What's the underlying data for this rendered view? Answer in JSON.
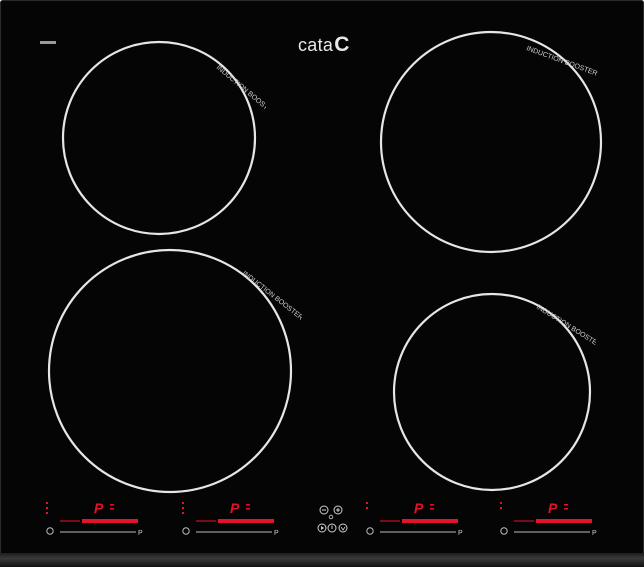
{
  "brand": {
    "name": "cata",
    "logo_mark": "C"
  },
  "zones": [
    {
      "id": "top-left",
      "label": "INDUCTION BOOSTER"
    },
    {
      "id": "bottom-left",
      "label": "INDUCTION BOOSTER"
    },
    {
      "id": "top-right",
      "label": "INDUCTION BOOSTER"
    },
    {
      "id": "bottom-right",
      "label": "INDUCTION BOOSTER"
    }
  ],
  "controls": {
    "zone_panels": [
      {
        "display": "P",
        "power_level_max": "P"
      },
      {
        "display": "P",
        "power_level_max": "P"
      },
      {
        "display": "P",
        "power_level_max": "P"
      },
      {
        "display": "P",
        "power_level_max": "P"
      }
    ],
    "timer": {
      "minus": "−",
      "plus": "+"
    }
  },
  "colors": {
    "glass": "#050505",
    "ring": "#e6e6e6",
    "indicator": "#e3122a"
  }
}
